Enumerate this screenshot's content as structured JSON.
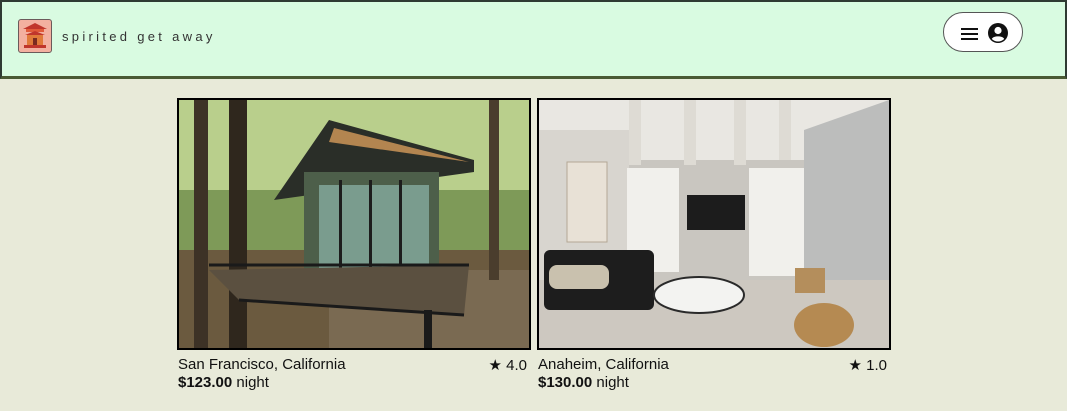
{
  "app": {
    "brand": "spirited get away"
  },
  "header": {
    "menu_icon": "hamburger-icon",
    "account_icon": "user-circle-icon"
  },
  "listings": [
    {
      "location": "San Francisco, California",
      "rating": "★ 4.0",
      "price": "$123.00",
      "unit": "night"
    },
    {
      "location": "Anaheim, California",
      "rating": "★ 1.0",
      "price": "$130.00",
      "unit": "night"
    }
  ],
  "colors": {
    "header_bg": "#d9fbe1",
    "page_bg": "#e8ead9",
    "logo_bg": "#f3b0a0"
  }
}
